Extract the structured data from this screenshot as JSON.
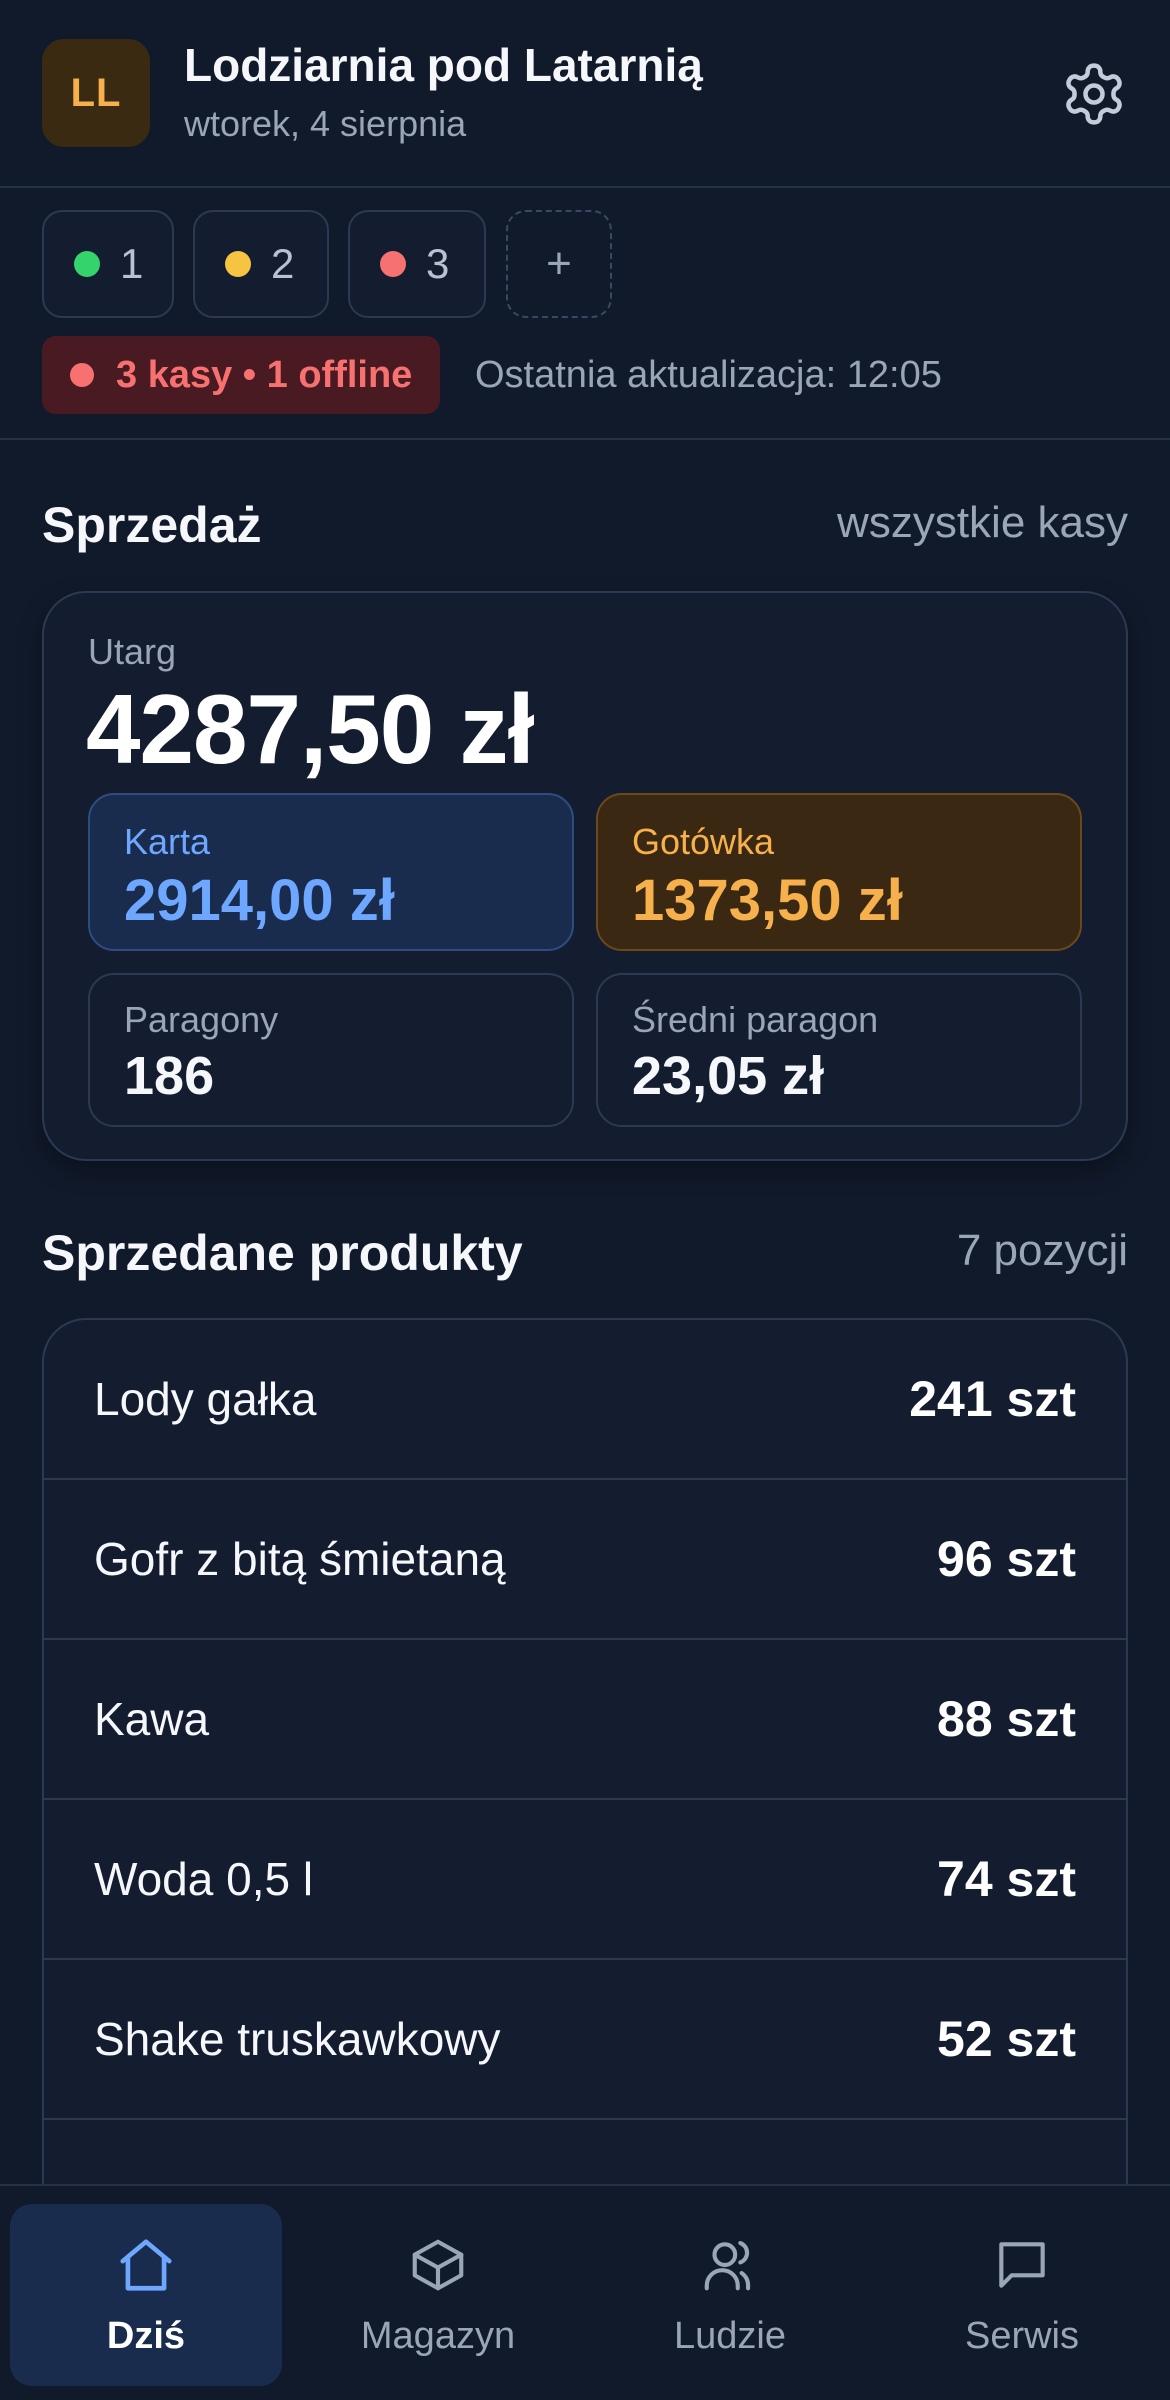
{
  "header": {
    "avatar_initials": "LL",
    "shop_name": "Lodziarnia pod Latarnią",
    "date": "wtorek, 4 sierpnia",
    "settings_icon": "gear-icon"
  },
  "registers": {
    "items": [
      {
        "label": "1",
        "status_color": "#34d36b"
      },
      {
        "label": "2",
        "status_color": "#f5c542"
      },
      {
        "label": "3",
        "status_color": "#f87171"
      }
    ],
    "add_label": "+",
    "status_text": "3 kasy • 1 offline",
    "last_update": "Ostatnia aktualizacja: 12:05"
  },
  "sales": {
    "title": "Sprzedaż",
    "filter": "wszystkie kasy",
    "revenue_label": "Utarg",
    "revenue_value": "4287,50 zł",
    "card_label": "Karta",
    "card_value": "2914,00 zł",
    "cash_label": "Gotówka",
    "cash_value": "1373,50 zł",
    "receipts_label": "Paragony",
    "receipts_value": "186",
    "avg_label": "Średni paragon",
    "avg_value": "23,05 zł"
  },
  "products": {
    "title": "Sprzedane produkty",
    "count": "7 pozycji",
    "items": [
      {
        "name": "Lody gałka",
        "qty": "241 szt"
      },
      {
        "name": "Gofr z bitą śmietaną",
        "qty": "96 szt"
      },
      {
        "name": "Kawa",
        "qty": "88 szt"
      },
      {
        "name": "Woda 0,5 l",
        "qty": "74 szt"
      },
      {
        "name": "Shake truskawkowy",
        "qty": "52 szt"
      }
    ]
  },
  "nav": {
    "items": [
      {
        "label": "Dziś",
        "icon": "home-icon",
        "active": true
      },
      {
        "label": "Magazyn",
        "icon": "box-icon",
        "active": false
      },
      {
        "label": "Ludzie",
        "icon": "users-icon",
        "active": false
      },
      {
        "label": "Serwis",
        "icon": "chat-icon",
        "active": false
      }
    ]
  },
  "colors": {
    "background": "#111a2b",
    "accent_blue": "#6ea7ff",
    "accent_orange": "#f6b04c",
    "alert_red": "#f87171"
  }
}
